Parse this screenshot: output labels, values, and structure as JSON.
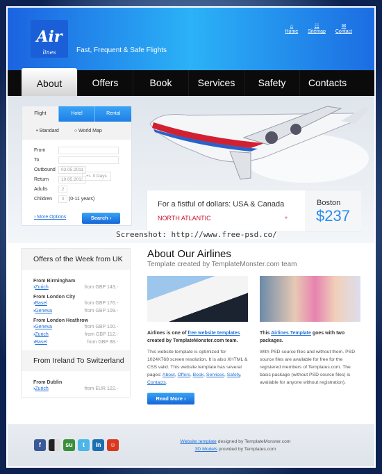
{
  "header": {
    "logo_text": "Air",
    "logo_sub": "lines",
    "tagline": "Fast, Frequent & Safe Flights",
    "links": [
      {
        "label": "Home",
        "icon": "home-icon"
      },
      {
        "label": "Sitemap",
        "icon": "sitemap-icon"
      },
      {
        "label": "Contact",
        "icon": "mail-icon"
      }
    ]
  },
  "nav": [
    "About",
    "Offers",
    "Book",
    "Services",
    "Safety",
    "Contacts"
  ],
  "search": {
    "tabs": [
      "Flight",
      "Hotel",
      "Rental"
    ],
    "radios": [
      "Standard",
      "World Map"
    ],
    "labels": {
      "from": "From",
      "to": "To",
      "outbound": "Outbound",
      "return": "Return",
      "adults": "Adults",
      "children": "Children"
    },
    "outbound": "03.05.2011",
    "return": "10.05.2011",
    "days": "+/- 0 Days",
    "adults": "2",
    "children": "0",
    "children_note": "(0-11 years)",
    "more": "More Options",
    "button": "Search ›"
  },
  "promo": {
    "title": "For a fistful of dollars: USA & Canada",
    "subtitle": "NORTH ATLANTIC",
    "arrow": "»",
    "city": "Boston",
    "price": "$237"
  },
  "watermark": "Screenshot: http://www.free-psd.co/",
  "offers": {
    "title": "Offers of the Week from UK",
    "groups": [
      {
        "from": "From Birmingham",
        "items": [
          {
            "city": "Zurich",
            "price": "from GBP 143.-"
          }
        ]
      },
      {
        "from": "From London City",
        "items": [
          {
            "city": "Basel",
            "price": "from GBP 176.-"
          },
          {
            "city": "Geneva",
            "price": "from GBP 109.-"
          }
        ]
      },
      {
        "from": "From London Heathrow",
        "items": [
          {
            "city": "Geneva",
            "price": "from GBP 100.-"
          },
          {
            "city": "Zurich",
            "price": "from GBP 112.-"
          },
          {
            "city": "Basel",
            "price": "from GBP 88.-"
          }
        ]
      }
    ],
    "title2": "From Ireland To Switzerland",
    "group2": {
      "from": "From Dublin",
      "items": [
        {
          "city": "Zurich",
          "price": "from EUR 122.-"
        }
      ]
    }
  },
  "main": {
    "title": "About Our Airlines",
    "subtitle": "Template created by TemplateMonster.com team",
    "col1": {
      "b1": "Airlines is one of ",
      "link": "free website templates",
      "b2": " created by TemplateMonster.com team.",
      "p": "This website template is optimized for 1024X768 screen resolution. It is also XHTML & CSS valid. This website template has several pages: ",
      "pages": [
        "About",
        "Offers",
        "Book",
        "Services",
        "Safety",
        "Contacts"
      ],
      "button": "Read More ›"
    },
    "col2": {
      "b1": "This ",
      "link": "Airlines Template",
      "b2": " goes with two packages.",
      "p": "With PSD source files and without them. PSD source files are available for free for the registered members of Templates.com. The basic package (without PSD source files) is available for anyone without registration)."
    }
  },
  "footer": {
    "social": [
      "facebook",
      "delicious",
      "stumbleupon",
      "twitter",
      "linkedin",
      "reddit"
    ],
    "line1_link": "Website template",
    "line1": " designed by TemplateMonster.com",
    "line2_link": "3D Models",
    "line2": " provided by Templates.com"
  }
}
